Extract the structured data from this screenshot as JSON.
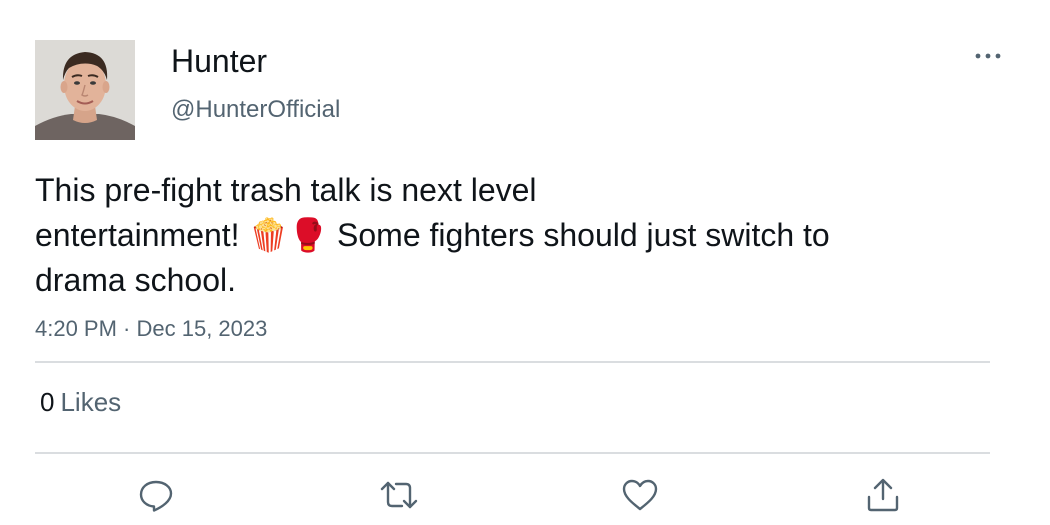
{
  "author": {
    "name": "Hunter",
    "handle": "@HunterOfficial",
    "avatar_alt": "Hunter profile photo"
  },
  "tweet": {
    "text": "This pre-fight trash talk is  next level\nentertainment! 🍿🥊 Some fighters should just switch to\ndrama school.",
    "timestamp": "4:20 PM · Dec 15, 2023"
  },
  "stats": {
    "likes_count": "0",
    "likes_label": "Likes"
  },
  "icons": {
    "more": "more-horizontal-icon",
    "reply": "reply-bubble-icon",
    "retweet": "retweet-arrows-icon",
    "like": "heart-icon",
    "share": "share-upload-icon"
  },
  "colors": {
    "text_primary": "#0f1419",
    "text_secondary": "#536471",
    "divider": "#dadde0",
    "icon": "#536471"
  }
}
